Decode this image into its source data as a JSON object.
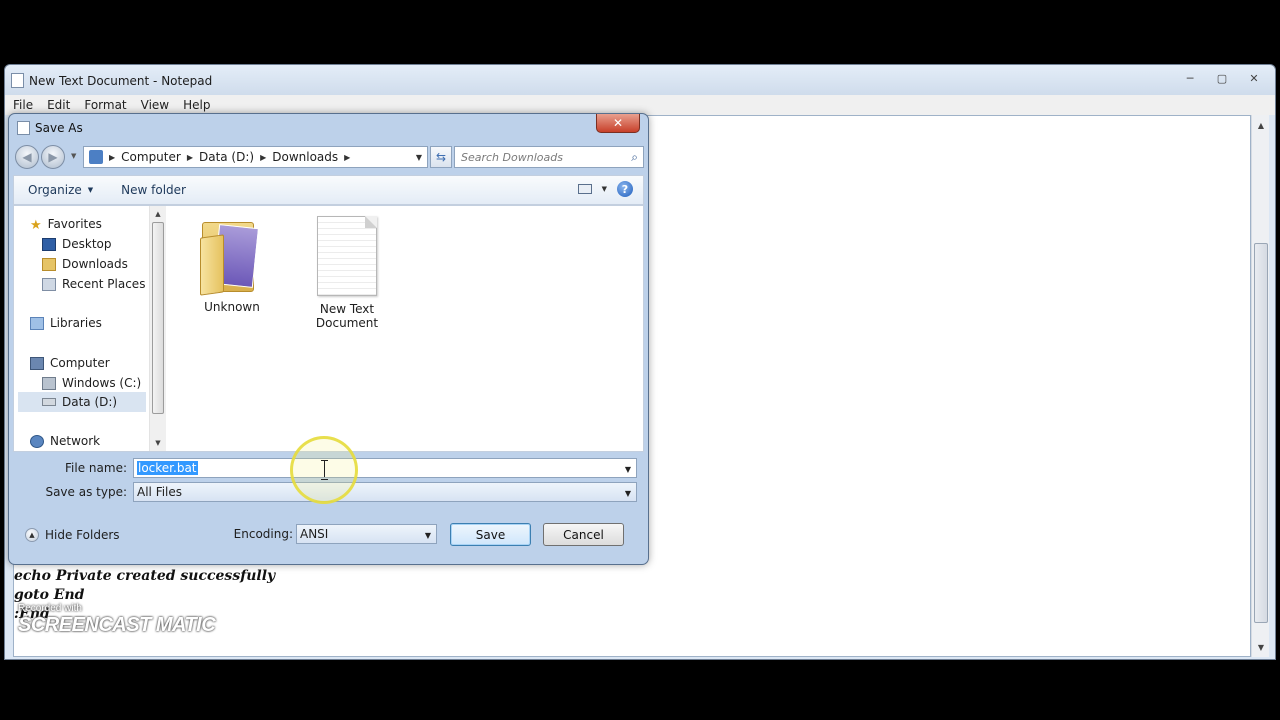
{
  "notepad": {
    "title": "New Text Document - Notepad",
    "menu": [
      "File",
      "Edit",
      "Format",
      "View",
      "Help"
    ],
    "lines": [
      "echo Private created successfully",
      "goto End",
      ":End"
    ]
  },
  "watermark": {
    "recorded": "Recorded with",
    "brand": "SCREENCAST MATIC"
  },
  "dialog": {
    "title": "Save As",
    "close": "✕",
    "breadcrumb": [
      "Computer",
      "Data (D:)",
      "Downloads"
    ],
    "search_placeholder": "Search Downloads",
    "organize": "Organize",
    "new_folder": "New folder",
    "help": "?",
    "nav": {
      "favorites": "Favorites",
      "desktop": "Desktop",
      "downloads": "Downloads",
      "recent": "Recent Places",
      "libraries": "Libraries",
      "computer": "Computer",
      "windows_c": "Windows (C:)",
      "data_d": "Data (D:)",
      "network": "Network"
    },
    "files": [
      {
        "name": "Unknown",
        "icon": "folder-icon"
      },
      {
        "name": "New Text\nDocument",
        "icon": "text-document-icon"
      }
    ],
    "file_name_label": "File name:",
    "file_name_value": "locker.bat",
    "save_as_type_label": "Save as type:",
    "save_as_type_value": "All Files",
    "hide_folders": "Hide Folders",
    "encoding_label": "Encoding:",
    "encoding_value": "ANSI",
    "save": "Save",
    "cancel": "Cancel"
  },
  "colors": {
    "title_bar": "#bdd1ea",
    "selection": "#3399ff",
    "close_red": "#c7402a",
    "cursor_highlight": "#e6dc3c"
  }
}
